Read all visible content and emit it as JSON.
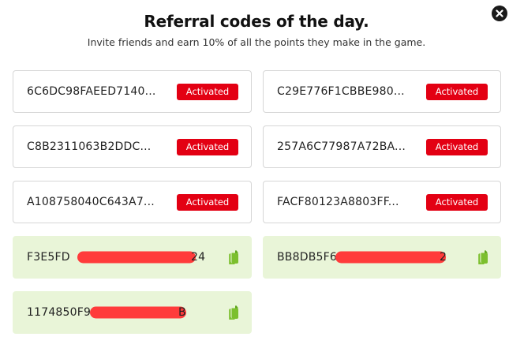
{
  "header": {
    "title": "Referral codes of the day.",
    "subtitle": "Invite friends and earn 10% of all the points they make in the game."
  },
  "icons": {
    "close": "close-icon",
    "copy": "copy-icon"
  },
  "colors": {
    "badge": "#e30013",
    "unused_card": "#e9f5d8",
    "copy_icon": "#7cbf2e"
  },
  "codes": [
    {
      "code": "6C6DC98FAEED7140...",
      "status": "Activated"
    },
    {
      "code": "C29E776F1CBBE980...",
      "status": "Activated"
    },
    {
      "code": "C8B2311063B2DDC...",
      "status": "Activated"
    },
    {
      "code": "257A6C77987A72BA...",
      "status": "Activated"
    },
    {
      "code": "A108758040C643A7...",
      "status": "Activated"
    },
    {
      "code": "FACF80123A8803FF...",
      "status": "Activated"
    },
    {
      "code_visible_start": "F3E5FD",
      "code_visible_end": "24"
    },
    {
      "code_visible_start": "BB8DB5F6",
      "code_visible_end": "2"
    },
    {
      "code_visible_start": "1174850F9",
      "code_visible_end": "B"
    }
  ]
}
